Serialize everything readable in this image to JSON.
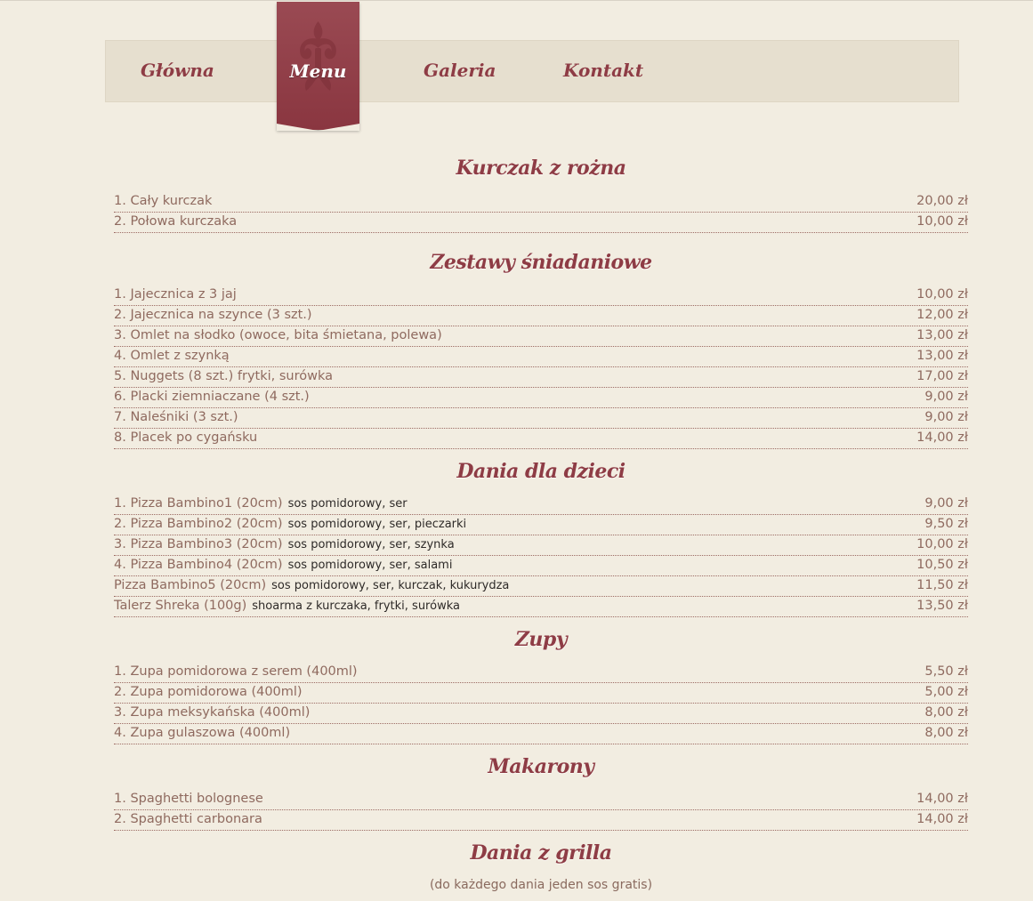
{
  "nav": {
    "items": [
      {
        "label": "Główna"
      },
      {
        "label": "Menu",
        "active": true
      },
      {
        "label": "Galeria"
      },
      {
        "label": "Kontakt"
      }
    ]
  },
  "colors": {
    "accent": "#8e3c45",
    "background": "#f2ede1",
    "nav_bar": "#e6dfcf",
    "text": "#8f6a5f"
  },
  "sections": [
    {
      "title": "Kurczak z rożna",
      "items": [
        {
          "name": "1. Cały kurczak",
          "desc": "",
          "price": "20,00 zł"
        },
        {
          "name": "2. Połowa kurczaka",
          "desc": "",
          "price": "10,00 zł"
        }
      ]
    },
    {
      "title": "Zestawy śniadaniowe",
      "items": [
        {
          "name": "1. Jajecznica z 3 jaj",
          "desc": "",
          "price": "10,00 zł"
        },
        {
          "name": "2. Jajecznica na szynce (3 szt.)",
          "desc": "",
          "price": "12,00 zł"
        },
        {
          "name": "3. Omlet na słodko (owoce, bita śmietana, polewa)",
          "desc": "",
          "price": "13,00 zł"
        },
        {
          "name": "4. Omlet z szynką",
          "desc": "",
          "price": "13,00 zł"
        },
        {
          "name": "5. Nuggets (8 szt.) frytki, surówka",
          "desc": "",
          "price": "17,00 zł"
        },
        {
          "name": "6. Placki ziemniaczane (4 szt.)",
          "desc": "",
          "price": "9,00 zł"
        },
        {
          "name": "7. Naleśniki (3 szt.)",
          "desc": "",
          "price": "9,00 zł"
        },
        {
          "name": "8. Placek po cygańsku",
          "desc": "",
          "price": "14,00 zł"
        }
      ]
    },
    {
      "title": "Dania dla dzieci",
      "items": [
        {
          "name": "1. Pizza Bambino1 (20cm)",
          "desc": "sos pomidorowy, ser",
          "price": "9,00 zł"
        },
        {
          "name": "2. Pizza Bambino2 (20cm)",
          "desc": "sos pomidorowy, ser, pieczarki",
          "price": "9,50 zł"
        },
        {
          "name": "3. Pizza Bambino3 (20cm)",
          "desc": "sos pomidorowy, ser, szynka",
          "price": "10,00 zł"
        },
        {
          "name": "4. Pizza Bambino4 (20cm)",
          "desc": "sos pomidorowy, ser, salami",
          "price": "10,50 zł"
        },
        {
          "name": "Pizza Bambino5 (20cm)",
          "desc": "sos pomidorowy, ser, kurczak, kukurydza",
          "price": "11,50 zł"
        },
        {
          "name": "Talerz Shreka (100g)",
          "desc": "shoarma z kurczaka, frytki, surówka",
          "price": "13,50 zł"
        }
      ]
    },
    {
      "title": "Zupy",
      "items": [
        {
          "name": "1. Zupa pomidorowa z serem (400ml)",
          "desc": "",
          "price": "5,50 zł"
        },
        {
          "name": "2. Zupa pomidorowa (400ml)",
          "desc": "",
          "price": "5,00 zł"
        },
        {
          "name": "3. Zupa meksykańska (400ml)",
          "desc": "",
          "price": "8,00 zł"
        },
        {
          "name": "4. Zupa gulaszowa (400ml)",
          "desc": "",
          "price": "8,00 zł"
        }
      ]
    },
    {
      "title": "Makarony",
      "items": [
        {
          "name": "1. Spaghetti bolognese",
          "desc": "",
          "price": "14,00 zł"
        },
        {
          "name": "2. Spaghetti carbonara",
          "desc": "",
          "price": "14,00 zł"
        }
      ]
    },
    {
      "title": "Dania z grilla",
      "note": "(do każdego dania jeden sos gratis)",
      "items": []
    }
  ]
}
